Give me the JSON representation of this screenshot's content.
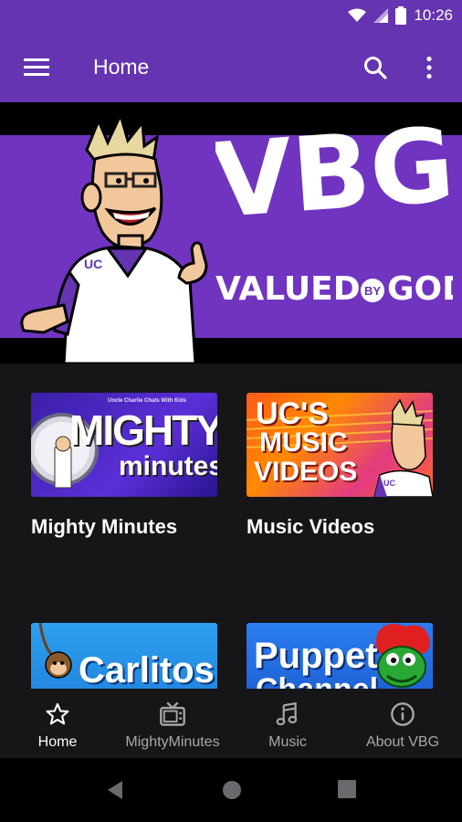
{
  "status_bar": {
    "time": "10:26"
  },
  "app_bar": {
    "title": "Home"
  },
  "hero": {
    "logo": "VBG",
    "tagline_left": "VALUED",
    "tagline_by": "BY",
    "tagline_right": "GOD",
    "mascot_badge": "UC"
  },
  "tiles": [
    {
      "label": "Mighty Minutes",
      "thumb": {
        "line1": "MIGHTY",
        "line2": "minutes",
        "small": "Uncle Charlie Chats With Kids"
      }
    },
    {
      "label": "Music Videos",
      "thumb": {
        "line1": "UC'S",
        "line2": "MUSIC",
        "line3": "VIDEOS",
        "badge": "UC"
      }
    },
    {
      "label": "",
      "thumb": {
        "line1": "Carlitos"
      }
    },
    {
      "label": "",
      "thumb": {
        "line1": "Puppet",
        "line2": "Channel"
      }
    }
  ],
  "bottom_nav": [
    {
      "label": "Home",
      "icon": "star-icon",
      "active": true
    },
    {
      "label": "MightyMinutes",
      "icon": "tv-icon",
      "active": false
    },
    {
      "label": "Music",
      "icon": "music-note-icon",
      "active": false
    },
    {
      "label": "About VBG",
      "icon": "info-icon",
      "active": false
    }
  ]
}
